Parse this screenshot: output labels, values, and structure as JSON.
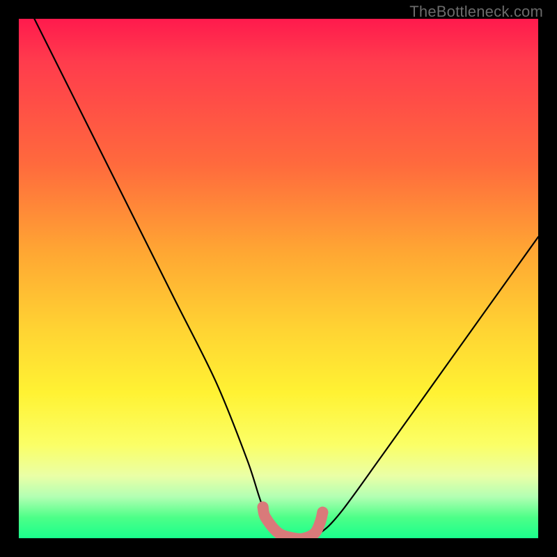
{
  "attribution": "TheBottleneck.com",
  "chart_data": {
    "type": "line",
    "title": "",
    "xlabel": "",
    "ylabel": "",
    "xlim": [
      0,
      100
    ],
    "ylim": [
      0,
      100
    ],
    "series": [
      {
        "name": "bottleneck-curve",
        "x": [
          3,
          10,
          20,
          30,
          38,
          44,
          47,
          50,
          53,
          55,
          58,
          62,
          70,
          80,
          90,
          100
        ],
        "y": [
          100,
          86,
          66,
          46,
          30,
          15,
          6,
          1,
          0,
          0,
          1,
          5,
          16,
          30,
          44,
          58
        ]
      }
    ],
    "markers": {
      "name": "optimum-band",
      "color": "#d97a7a",
      "points": [
        {
          "x": 47,
          "y": 6
        },
        {
          "x": 47.5,
          "y": 4
        },
        {
          "x": 50,
          "y": 1
        },
        {
          "x": 53,
          "y": 0
        },
        {
          "x": 55,
          "y": 0
        },
        {
          "x": 57,
          "y": 1
        },
        {
          "x": 58,
          "y": 3
        },
        {
          "x": 58.5,
          "y": 5
        }
      ]
    },
    "background_gradient": {
      "top": "#ff1a4d",
      "bottom": "#1aff8c"
    }
  }
}
